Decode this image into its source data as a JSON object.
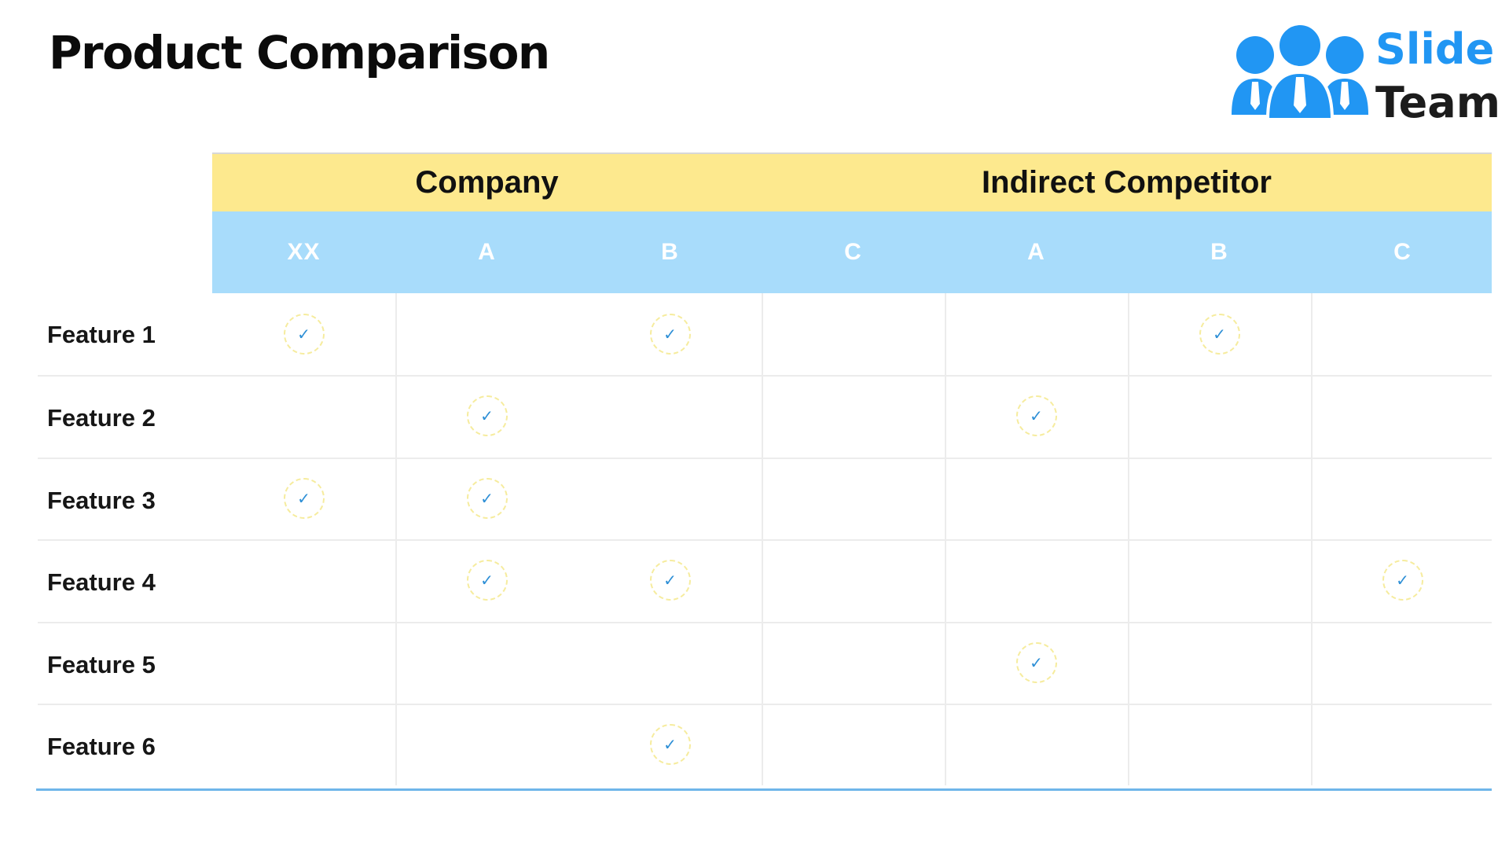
{
  "title": "Product Comparison",
  "logo": {
    "word1": "Slide",
    "word2": "Team",
    "icon": "people-group-icon",
    "colors": {
      "brand": "#2196f3",
      "dark": "#1c1c1c"
    }
  },
  "table": {
    "groups": [
      "Company",
      "Indirect Competitor"
    ],
    "columns": [
      "XX",
      "A",
      "B",
      "C",
      "A",
      "B",
      "C"
    ],
    "rows": [
      {
        "label": "Feature 1",
        "checks": [
          true,
          false,
          true,
          false,
          false,
          true,
          false
        ]
      },
      {
        "label": "Feature 2",
        "checks": [
          false,
          true,
          false,
          false,
          true,
          false,
          false
        ]
      },
      {
        "label": "Feature 3",
        "checks": [
          true,
          true,
          false,
          false,
          false,
          false,
          false
        ]
      },
      {
        "label": "Feature 4",
        "checks": [
          false,
          true,
          true,
          false,
          false,
          false,
          true
        ]
      },
      {
        "label": "Feature 5",
        "checks": [
          false,
          false,
          false,
          false,
          true,
          false,
          false
        ]
      },
      {
        "label": "Feature 6",
        "checks": [
          false,
          false,
          true,
          false,
          false,
          false,
          false
        ]
      }
    ],
    "check_symbol": "✓",
    "colors": {
      "group_header": "#fde98e",
      "column_header": "#a8dcfb",
      "check": "#2d8fd6",
      "bottom_rule": "#6fb6ea"
    }
  }
}
